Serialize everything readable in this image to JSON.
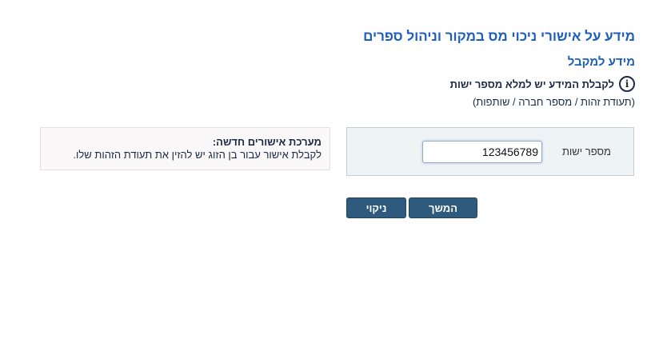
{
  "page": {
    "title": "מידע על אישורי ניכוי מס במקור וניהול ספרים",
    "section_title": "מידע למקבל"
  },
  "info": {
    "icon": "info-icon",
    "text": "לקבלת המידע יש למלא מספר ישות",
    "subtext": "(תעודת זהות / מספר חברה / שותפות)"
  },
  "form": {
    "entity_label": "מספר ישות",
    "entity_value": "123456789"
  },
  "notice": {
    "title": "מערכת אישורים חדשה:",
    "text": "לקבלת אישור עבור בן הזוג יש להזין את תעודת הזהות שלו."
  },
  "buttons": {
    "continue_label": "המשך",
    "clear_label": "ניקוי"
  },
  "colors": {
    "title": "#1e5ebd",
    "button": "#2e5b7d",
    "panel": "#eef3f6"
  }
}
